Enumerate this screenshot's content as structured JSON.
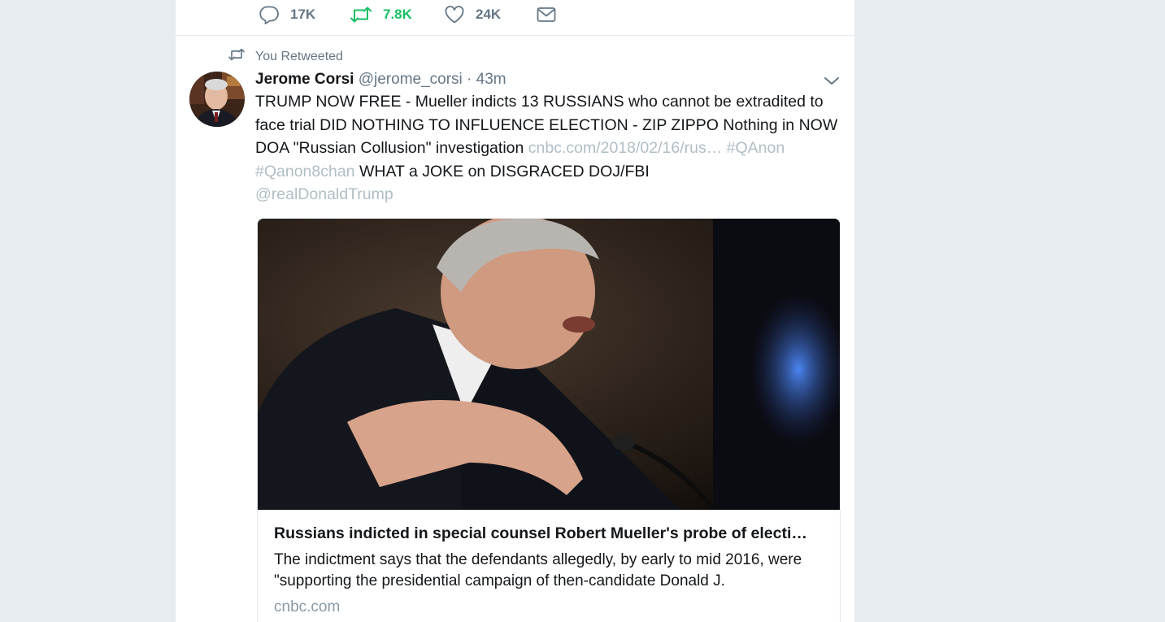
{
  "prev_tweet_actions": {
    "reply_count": "17K",
    "retweet_count": "7.8K",
    "like_count": "24K"
  },
  "tweet": {
    "context": "You Retweeted",
    "author_name": "Jerome Corsi",
    "author_handle": "@jerome_corsi",
    "separator": "·",
    "time": "43m",
    "text_main": "TRUMP NOW FREE - Mueller indicts 13 RUSSIANS who cannot be extradited to face trial DID NOTHING TO INFLUENCE ELECTION - ZIP ZIPPO Nothing in NOW DOA \"Russian Collusion\" investigation",
    "url_display": "cnbc.com/2018/02/16/rus…",
    "hashtag_1": "#QAnon",
    "hashtag_2": "#Qanon8chan",
    "text_after_hashtags": "WHAT a JOKE on DISGRACED DOJ/FBI",
    "mention": "@realDonaldTrump"
  },
  "card": {
    "title": "Russians indicted in special counsel Robert Mueller's probe of electi…",
    "description": "The indictment says that the defendants allegedly, by early to mid 2016, were \"supporting the presidential campaign of then-candidate Donald J.",
    "domain": "cnbc.com"
  },
  "colors": {
    "retweet_active": "#17bf63",
    "muted_text": "#657786",
    "link_text": "#b0bec5",
    "border": "#e6ecf0",
    "background": "#e6ecf0"
  },
  "icons": {
    "reply": "speech-bubble-icon",
    "retweet": "retweet-arrows-icon",
    "like": "heart-outline-icon",
    "dm": "envelope-icon",
    "caret": "chevron-down-icon"
  }
}
